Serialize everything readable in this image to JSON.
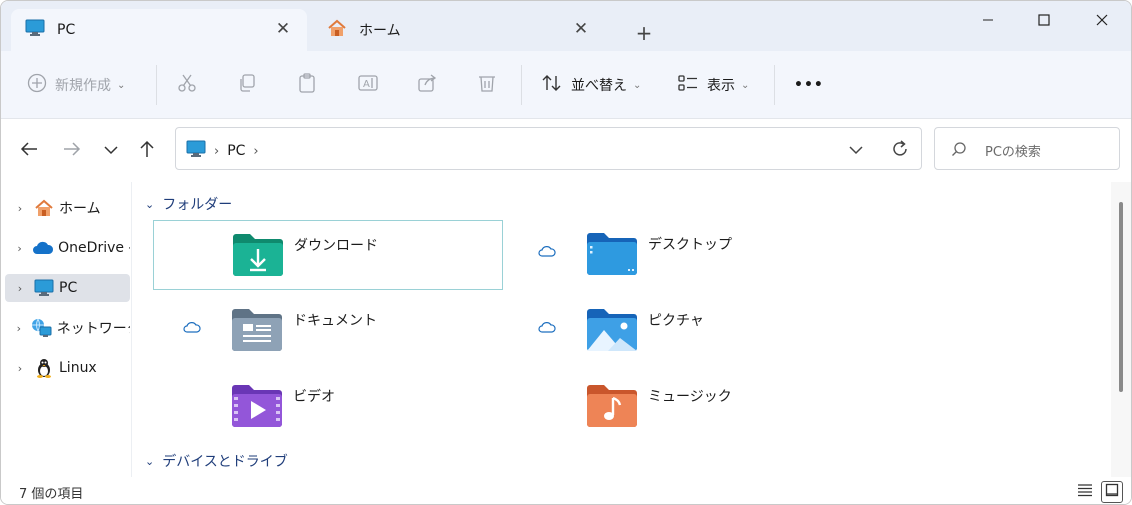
{
  "tabs": [
    {
      "label": "PC",
      "icon": "monitor-icon",
      "active": true
    },
    {
      "label": "ホーム",
      "icon": "home-icon",
      "active": false
    }
  ],
  "toolbar": {
    "new_label": "新規作成",
    "sort_label": "並べ替え",
    "view_label": "表示",
    "more_label": "•••"
  },
  "address": {
    "crumbs": [
      "PC"
    ]
  },
  "search": {
    "placeholder": "PCの検索"
  },
  "sidebar": {
    "items": [
      {
        "label": "ホーム",
        "icon": "home-icon"
      },
      {
        "label": "OneDrive -",
        "icon": "onedrive-icon"
      },
      {
        "label": "PC",
        "icon": "monitor-icon",
        "selected": true
      },
      {
        "label": "ネットワーク",
        "icon": "network-icon"
      },
      {
        "label": "Linux",
        "icon": "linux-icon"
      }
    ]
  },
  "groups": {
    "folders": "フォルダー",
    "devices": "デバイスとドライブ"
  },
  "folders": [
    {
      "name": "ダウンロード",
      "icon": "downloads-folder-icon",
      "cloud": false,
      "selected": true
    },
    {
      "name": "デスクトップ",
      "icon": "desktop-folder-icon",
      "cloud": true
    },
    {
      "name": "ドキュメント",
      "icon": "documents-folder-icon",
      "cloud": true
    },
    {
      "name": "ピクチャ",
      "icon": "pictures-folder-icon",
      "cloud": true
    },
    {
      "name": "ビデオ",
      "icon": "videos-folder-icon",
      "cloud": false
    },
    {
      "name": "ミュージック",
      "icon": "music-folder-icon",
      "cloud": false
    }
  ],
  "status": {
    "item_count": "7 個の項目"
  },
  "colors": {
    "accent": "#1f3d7a",
    "selection_border": "#9ad1d6",
    "tabbar_bg": "#e9eef7"
  }
}
